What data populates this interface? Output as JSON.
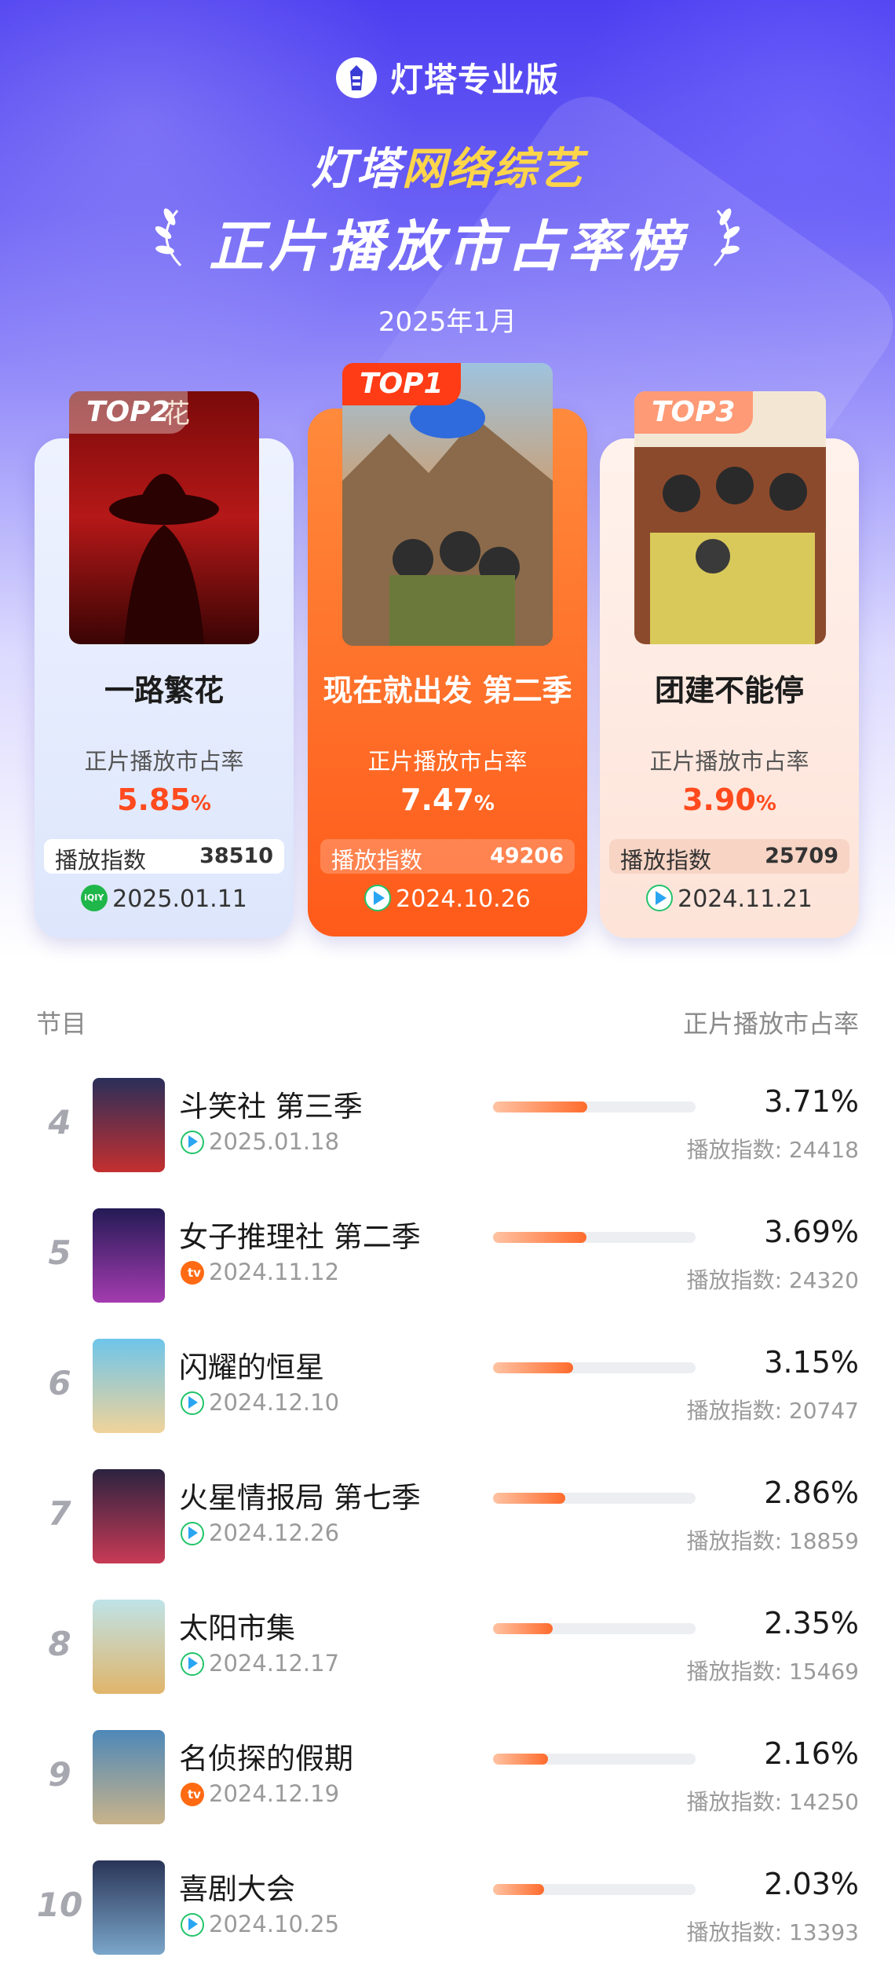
{
  "header": {
    "brand": "灯塔专业版",
    "title_line1_a": "灯塔",
    "title_line1_b": "网络综艺",
    "title_line2": "正片播放市占率榜",
    "month": "2025年1月"
  },
  "podium": [
    {
      "tag": "TOP1",
      "name": "现在就出发 第二季",
      "share_label": "正片播放市占率",
      "share": "7.47",
      "unit": "%",
      "index_label": "播放指数",
      "index": "49206",
      "platform": "tencent-video-icon",
      "date": "2024.10.26"
    },
    {
      "tag": "TOP2",
      "name": "一路繁花",
      "share_label": "正片播放市占率",
      "share": "5.85",
      "unit": "%",
      "index_label": "播放指数",
      "index": "38510",
      "platform": "iqiyi-icon",
      "date": "2025.01.11"
    },
    {
      "tag": "TOP3",
      "name": "团建不能停",
      "share_label": "正片播放市占率",
      "share": "3.90",
      "unit": "%",
      "index_label": "播放指数",
      "index": "25709",
      "platform": "tencent-video-icon",
      "date": "2024.11.21"
    }
  ],
  "list_header": {
    "left": "节目",
    "right": "正片播放市占率"
  },
  "list": [
    {
      "rank": "4",
      "name": "斗笑社 第三季",
      "platform": "tencent-video-icon",
      "date": "2025.01.18",
      "share": "3.71%",
      "share_value": 3.71,
      "index_text": "播放指数: 24418"
    },
    {
      "rank": "5",
      "name": "女子推理社 第二季",
      "platform": "mango-tv-icon",
      "date": "2024.11.12",
      "share": "3.69%",
      "share_value": 3.69,
      "index_text": "播放指数: 24320"
    },
    {
      "rank": "6",
      "name": "闪耀的恒星",
      "platform": "tencent-video-icon",
      "date": "2024.12.10",
      "share": "3.15%",
      "share_value": 3.15,
      "index_text": "播放指数: 20747"
    },
    {
      "rank": "7",
      "name": "火星情报局 第七季",
      "platform": "youku-icon",
      "date": "2024.12.26",
      "share": "2.86%",
      "share_value": 2.86,
      "index_text": "播放指数: 18859"
    },
    {
      "rank": "8",
      "name": "太阳市集",
      "platform": "tencent-video-icon",
      "date": "2024.12.17",
      "share": "2.35%",
      "share_value": 2.35,
      "index_text": "播放指数: 15469"
    },
    {
      "rank": "9",
      "name": "名侦探的假期",
      "platform": "mango-tv-icon",
      "date": "2024.12.19",
      "share": "2.16%",
      "share_value": 2.16,
      "index_text": "播放指数: 14250"
    },
    {
      "rank": "10",
      "name": "喜剧大会",
      "platform": "tencent-video-icon",
      "date": "2024.10.25",
      "share": "2.03%",
      "share_value": 2.03,
      "index_text": "播放指数: 13393"
    }
  ],
  "colors": {
    "accent": "#ff5a1a",
    "highlight": "#ffd54a",
    "header_bg": "#4d3ef0"
  }
}
